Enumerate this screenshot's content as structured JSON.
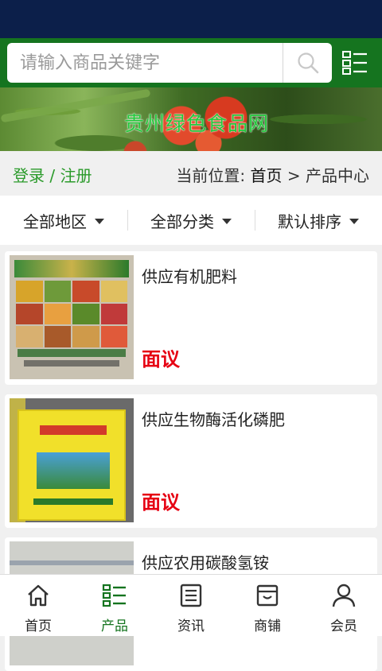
{
  "search": {
    "placeholder": "请输入商品关键字"
  },
  "banner": {
    "title": "贵州绿色食品网"
  },
  "breadcrumb": {
    "login": "登录 / 注册",
    "location_label": "当前位置:",
    "home": "首页",
    "separator": ">",
    "current": "产品中心"
  },
  "filters": [
    {
      "label": "全部地区"
    },
    {
      "label": "全部分类"
    },
    {
      "label": "默认排序"
    }
  ],
  "products": [
    {
      "name": "供应有机肥料",
      "price": "面议"
    },
    {
      "name": "供应生物酶活化磷肥",
      "price": "面议"
    },
    {
      "name": "供应农用碳酸氢铵",
      "price": ""
    }
  ],
  "tabs": [
    {
      "label": "首页",
      "icon": "home-icon",
      "active": false
    },
    {
      "label": "产品",
      "icon": "list-icon",
      "active": true
    },
    {
      "label": "资讯",
      "icon": "news-icon",
      "active": false
    },
    {
      "label": "商铺",
      "icon": "shop-icon",
      "active": false
    },
    {
      "label": "会员",
      "icon": "user-icon",
      "active": false
    }
  ],
  "colors": {
    "header_green": "#15741f",
    "status_bar": "#0c1f4a",
    "price_red": "#e60012",
    "link_green": "#2a9a2a"
  }
}
